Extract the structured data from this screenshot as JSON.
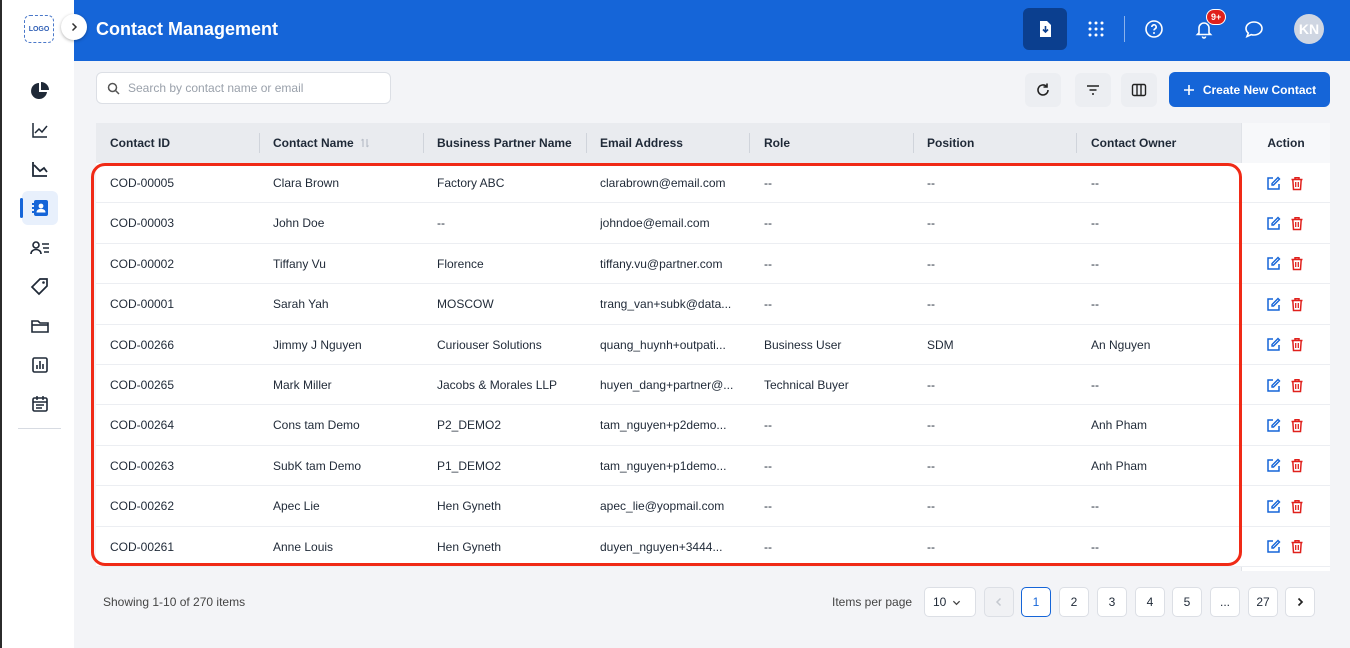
{
  "sidebar": {
    "logo_text": "LOGO",
    "items": [
      {
        "icon": "pie-chart-icon"
      },
      {
        "icon": "trend-line-icon"
      },
      {
        "icon": "area-chart-icon"
      },
      {
        "icon": "contacts-icon",
        "active": true
      },
      {
        "icon": "user-list-icon"
      },
      {
        "icon": "tag-icon"
      },
      {
        "icon": "folder-icon"
      },
      {
        "icon": "report-icon"
      },
      {
        "icon": "calendar-icon"
      }
    ]
  },
  "header": {
    "title": "Contact Management",
    "notification_badge": "9+",
    "avatar_initials": "KN"
  },
  "toolbar": {
    "search_placeholder": "Search by contact name or email",
    "create_label": "Create New Contact"
  },
  "table": {
    "columns": [
      "Contact ID",
      "Contact Name",
      "Business Partner Name",
      "Email Address",
      "Role",
      "Position",
      "Contact Owner"
    ],
    "action_header": "Action",
    "rows": [
      {
        "id": "COD-00005",
        "name": "Clara Brown",
        "partner": "Factory ABC",
        "email": "clarabrown@email.com",
        "role": "--",
        "position": "--",
        "owner": "--"
      },
      {
        "id": "COD-00003",
        "name": "John Doe",
        "partner": "--",
        "email": "johndoe@email.com",
        "role": "--",
        "position": "--",
        "owner": "--"
      },
      {
        "id": "COD-00002",
        "name": "Tiffany Vu",
        "partner": "Florence",
        "email": "tiffany.vu@partner.com",
        "role": "--",
        "position": "--",
        "owner": "--"
      },
      {
        "id": "COD-00001",
        "name": "Sarah Yah",
        "partner": "MOSCOW",
        "email": "trang_van+subk@data...",
        "role": "--",
        "position": "--",
        "owner": "--"
      },
      {
        "id": "COD-00266",
        "name": "Jimmy J Nguyen",
        "partner": "Curiouser Solutions",
        "email": "quang_huynh+outpati...",
        "role": "Business User",
        "position": "SDM",
        "owner": "An Nguyen"
      },
      {
        "id": "COD-00265",
        "name": "Mark Miller",
        "partner": "Jacobs & Morales LLP",
        "email": "huyen_dang+partner@...",
        "role": "Technical Buyer",
        "position": "--",
        "owner": "--"
      },
      {
        "id": "COD-00264",
        "name": "Cons tam Demo",
        "partner": "P2_DEMO2",
        "email": "tam_nguyen+p2demo...",
        "role": "--",
        "position": "--",
        "owner": "Anh Pham"
      },
      {
        "id": "COD-00263",
        "name": "SubK tam Demo",
        "partner": "P1_DEMO2",
        "email": "tam_nguyen+p1demo...",
        "role": "--",
        "position": "--",
        "owner": "Anh Pham"
      },
      {
        "id": "COD-00262",
        "name": "Apec Lie",
        "partner": "Hen Gyneth",
        "email": "apec_lie@yopmail.com",
        "role": "--",
        "position": "--",
        "owner": "--"
      },
      {
        "id": "COD-00261",
        "name": "Anne Louis",
        "partner": "Hen Gyneth",
        "email": "duyen_nguyen+3444...",
        "role": "--",
        "position": "--",
        "owner": "--"
      }
    ]
  },
  "pagination": {
    "showing": "Showing 1-10 of 270 items",
    "items_per_page_label": "Items per page",
    "items_per_page": "10",
    "pages": [
      "1",
      "2",
      "3",
      "4",
      "5",
      "...",
      "27"
    ],
    "current_page": "1"
  },
  "colors": {
    "brand": "#1565d8",
    "danger": "#e0201c",
    "highlight": "#f02a16"
  }
}
